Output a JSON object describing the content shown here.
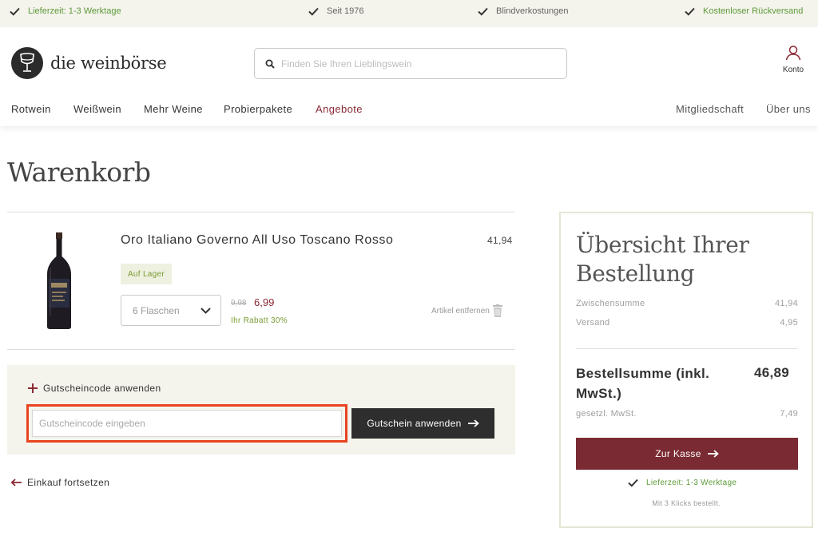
{
  "topbar": {
    "usps": [
      {
        "label": "Lieferzeit: 1-3 Werktage",
        "icon": "check-icon",
        "color": "#5c9b38"
      },
      {
        "label": "Seit 1976",
        "icon": "check-icon",
        "color": "#666666"
      },
      {
        "label": "Blindverkostungen",
        "icon": "check-icon",
        "color": "#666666"
      },
      {
        "label": "Kostenloser Rückversand",
        "icon": "check-icon",
        "color": "#5c9b38"
      }
    ]
  },
  "header": {
    "logo_text": "die weinbörse",
    "search_placeholder": "Finden Sie Ihren Lieblingswein",
    "account_label": "Konto"
  },
  "nav": {
    "items": [
      "Rotwein",
      "Weißwein",
      "Mehr Weine",
      "Probierpakete",
      "Angebote"
    ],
    "right_items": [
      "Mitgliedschaft",
      "Über uns"
    ]
  },
  "page_title": "Warenkorb",
  "cart": {
    "item": {
      "name": "Oro Italiano Governo All Uso Toscano Rosso",
      "total_price": "41,94",
      "stock_badge": "Auf Lager",
      "quantity": "6 Flaschen",
      "old_price": "9,98",
      "new_price": "6,99",
      "discount": "Ihr Rabatt 30%",
      "remove_label": "Artikel entfernen"
    }
  },
  "coupon": {
    "toggle_label": "Gutscheincode anwenden",
    "input_placeholder": "Gutscheincode eingeben",
    "button_label": "Gutschein anwenden"
  },
  "continue_label": "Einkauf fortsetzen",
  "summary": {
    "title": "Übersicht Ihrer Bestellung",
    "subtotal_label": "Zwischensumme",
    "subtotal_value": "41,94",
    "shipping_label": "Versand",
    "shipping_value": "4,95",
    "total_label": "Bestellsumme (inkl. MwSt.)",
    "total_value": "46,89",
    "vat_label": "gesetzl. MwSt.",
    "vat_value": "7,49",
    "checkout_label": "Zur Kasse",
    "delivery_label": "Lieferzeit: 1-3 Werktage",
    "note": "Mit 3 Klicks bestellt."
  },
  "colors": {
    "brand_red": "#7a2a32",
    "accent_green": "#5c9b38",
    "highlight_orange": "#e8441f",
    "topbar_bg": "#f4f3ec"
  }
}
